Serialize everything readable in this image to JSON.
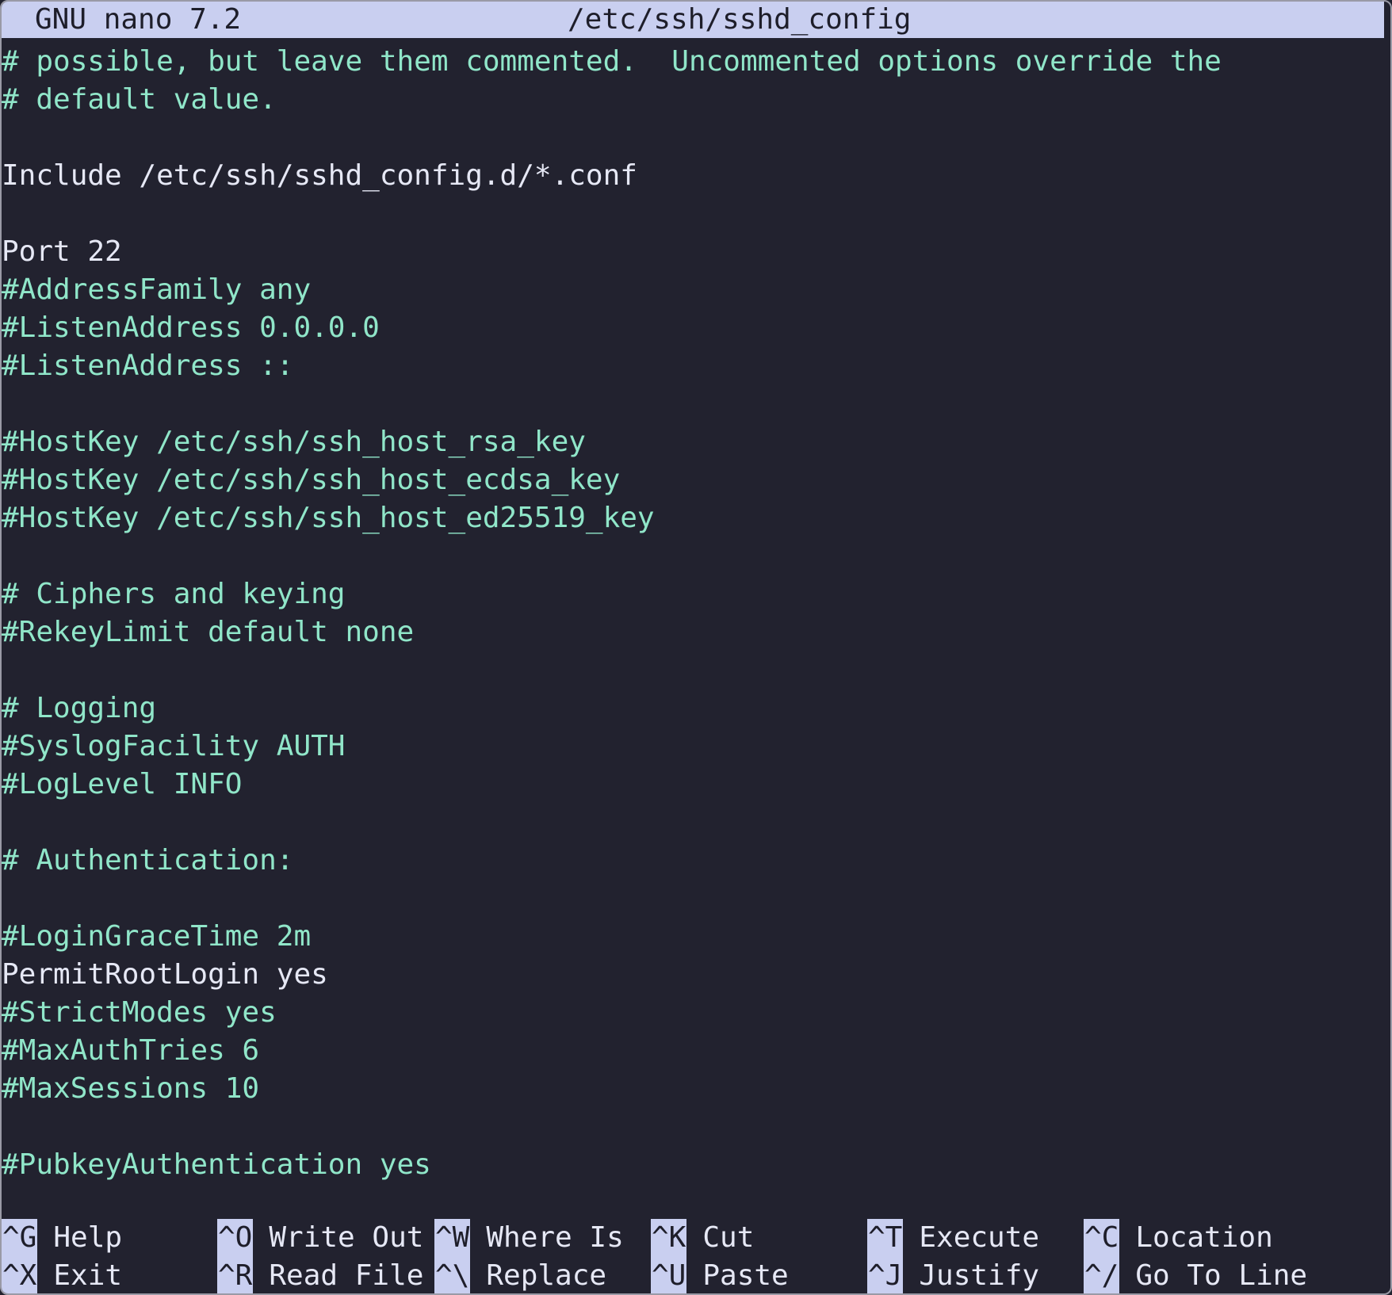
{
  "titlebar": {
    "app": "GNU nano 7.2",
    "filename": "/etc/ssh/sshd_config"
  },
  "colors": {
    "background": "#22222f",
    "titlebar_bg": "#c9cff0",
    "comment": "#90e6c9",
    "text": "#e6e8f5"
  },
  "lines": [
    {
      "text": "# possible, but leave them commented.  Uncommented options override the",
      "type": "comment"
    },
    {
      "text": "# default value.",
      "type": "comment"
    },
    {
      "text": "",
      "type": "blank"
    },
    {
      "text": "Include /etc/ssh/sshd_config.d/*.conf",
      "type": "directive"
    },
    {
      "text": "",
      "type": "blank"
    },
    {
      "text": "Port 22",
      "type": "directive"
    },
    {
      "text": "#AddressFamily any",
      "type": "comment"
    },
    {
      "text": "#ListenAddress 0.0.0.0",
      "type": "comment"
    },
    {
      "text": "#ListenAddress ::",
      "type": "comment"
    },
    {
      "text": "",
      "type": "blank"
    },
    {
      "text": "#HostKey /etc/ssh/ssh_host_rsa_key",
      "type": "comment"
    },
    {
      "text": "#HostKey /etc/ssh/ssh_host_ecdsa_key",
      "type": "comment"
    },
    {
      "text": "#HostKey /etc/ssh/ssh_host_ed25519_key",
      "type": "comment"
    },
    {
      "text": "",
      "type": "blank"
    },
    {
      "text": "# Ciphers and keying",
      "type": "comment"
    },
    {
      "text": "#RekeyLimit default none",
      "type": "comment"
    },
    {
      "text": "",
      "type": "blank"
    },
    {
      "text": "# Logging",
      "type": "comment"
    },
    {
      "text": "#SyslogFacility AUTH",
      "type": "comment"
    },
    {
      "text": "#LogLevel INFO",
      "type": "comment"
    },
    {
      "text": "",
      "type": "blank"
    },
    {
      "text": "# Authentication:",
      "type": "comment"
    },
    {
      "text": "",
      "type": "blank"
    },
    {
      "text": "#LoginGraceTime 2m",
      "type": "comment"
    },
    {
      "text": "PermitRootLogin yes",
      "type": "directive"
    },
    {
      "text": "#StrictModes yes",
      "type": "comment"
    },
    {
      "text": "#MaxAuthTries 6",
      "type": "comment"
    },
    {
      "text": "#MaxSessions 10",
      "type": "comment"
    },
    {
      "text": "",
      "type": "blank"
    },
    {
      "text": "#PubkeyAuthentication yes",
      "type": "comment"
    }
  ],
  "shortcuts": [
    {
      "key": "^G",
      "label": "Help"
    },
    {
      "key": "^O",
      "label": "Write Out"
    },
    {
      "key": "^W",
      "label": "Where Is"
    },
    {
      "key": "^K",
      "label": "Cut"
    },
    {
      "key": "^T",
      "label": "Execute"
    },
    {
      "key": "^C",
      "label": "Location"
    },
    {
      "key": "^X",
      "label": "Exit"
    },
    {
      "key": "^R",
      "label": "Read File"
    },
    {
      "key": "^\\",
      "label": "Replace"
    },
    {
      "key": "^U",
      "label": "Paste"
    },
    {
      "key": "^J",
      "label": "Justify"
    },
    {
      "key": "^/",
      "label": "Go To Line"
    }
  ]
}
